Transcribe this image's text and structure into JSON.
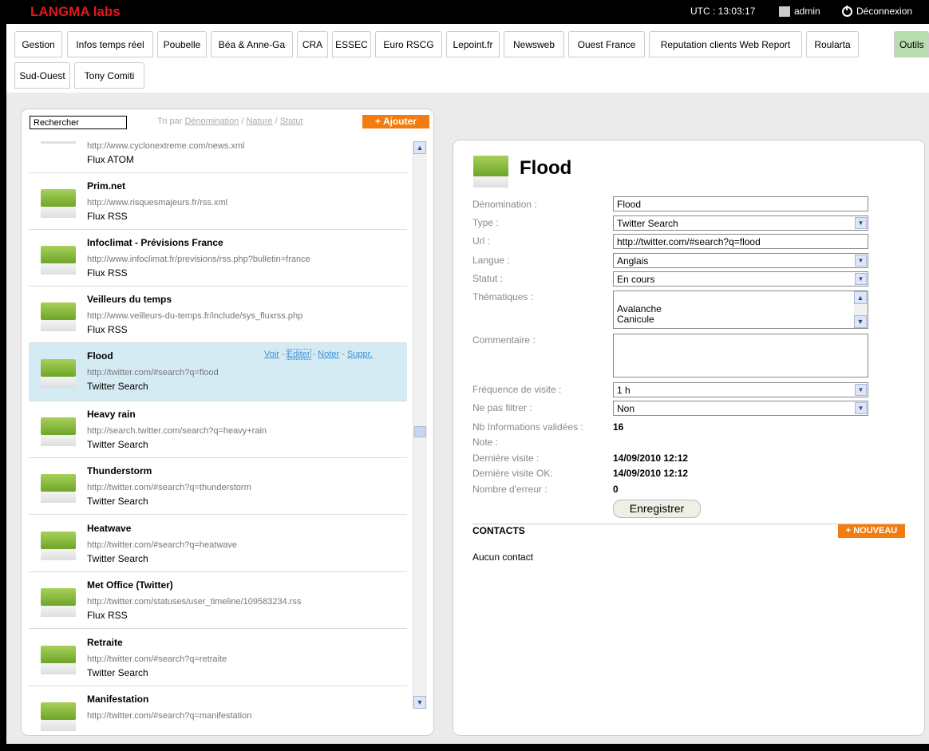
{
  "header": {
    "brand": "LANGMA labs",
    "utc": "UTC : 13:03:17",
    "user": "admin",
    "logout": "Déconnexion"
  },
  "tabs": [
    {
      "label": "Gestion"
    },
    {
      "label": "Infos temps réel"
    },
    {
      "label": "Poubelle"
    },
    {
      "label": "Béa & Anne-Ga"
    },
    {
      "label": "CRA"
    },
    {
      "label": "ESSEC"
    },
    {
      "label": "Euro RSCG"
    },
    {
      "label": "Lepoint.fr"
    },
    {
      "label": "Newsweb"
    },
    {
      "label": "Ouest France"
    },
    {
      "label": "Reputation clients Web Report"
    },
    {
      "label": "Roularta"
    },
    {
      "label": "Outils"
    },
    {
      "label": "Sud-Ouest"
    },
    {
      "label": "Tony Comiti"
    }
  ],
  "list": {
    "search_value": "Rechercher",
    "sort_prefix": "Tri par",
    "sort_1": "Dénomination",
    "sep_1": " / ",
    "sort_2": "Nature",
    "sep_2": " / ",
    "sort_3": "Statut",
    "add_label": "+ Ajouter",
    "actions": {
      "view": "Voir",
      "edit": "Editer",
      "rate": "Noter",
      "delete": "Suppr.",
      "dash": " - "
    },
    "items": [
      {
        "title": "",
        "url": "http://www.cyclonextreme.com/news.xml",
        "kind": "Flux ATOM"
      },
      {
        "title": "Prim.net",
        "url": "http://www.risquesmajeurs.fr/rss.xml",
        "kind": "Flux RSS"
      },
      {
        "title": "Infoclimat - Prévisions France",
        "url": "http://www.infoclimat.fr/previsions/rss.php?bulletin=france",
        "kind": "Flux RSS"
      },
      {
        "title": "Veilleurs du temps",
        "url": "http://www.veilleurs-du-temps.fr/include/sys_fluxrss.php",
        "kind": "Flux RSS"
      },
      {
        "title": "Flood",
        "url": "http://twitter.com/#search?q=flood",
        "kind": "Twitter Search"
      },
      {
        "title": "Heavy rain",
        "url": "http://search.twitter.com/search?q=heavy+rain",
        "kind": "Twitter Search"
      },
      {
        "title": "Thunderstorm",
        "url": "http://twitter.com/#search?q=thunderstorm",
        "kind": "Twitter Search"
      },
      {
        "title": "Heatwave",
        "url": "http://twitter.com/#search?q=heatwave",
        "kind": "Twitter Search"
      },
      {
        "title": "Met Office (Twitter)",
        "url": "http://twitter.com/statuses/user_timeline/109583234.rss",
        "kind": "Flux RSS"
      },
      {
        "title": "Retraite",
        "url": "http://twitter.com/#search?q=retraite",
        "kind": "Twitter Search"
      },
      {
        "title": "Manifestation",
        "url": "http://twitter.com/#search?q=manifestation",
        "kind": ""
      }
    ]
  },
  "detail": {
    "title": "Flood",
    "labels": {
      "name": "Dénomination :",
      "type": "Type :",
      "url": "Url :",
      "lang": "Langue :",
      "status": "Statut :",
      "themes": "Thématiques :",
      "comment": "Commentaire :",
      "freq": "Fréquence de visite :",
      "nofilter": "Ne pas filtrer :",
      "validated": "Nb Informations validées :",
      "note": "Note :",
      "last": "Dernière visite :",
      "last_ok": "Dernière visite OK:",
      "errors": "Nombre d'erreur :"
    },
    "values": {
      "name": "Flood",
      "type": "Twitter Search",
      "url": "http://twitter.com/#search?q=flood",
      "lang": "Anglais",
      "status": "En cours",
      "theme_1": "Avalanche",
      "theme_2": "Canicule",
      "freq": "1 h",
      "nofilter": "Non",
      "validated": "16",
      "last": "14/09/2010 12:12",
      "last_ok": "14/09/2010 12:12",
      "errors": "0"
    },
    "save_label": "Enregistrer",
    "contacts_title": "CONTACTS",
    "new_label": "+ NOUVEAU",
    "no_contact": "Aucun contact"
  }
}
